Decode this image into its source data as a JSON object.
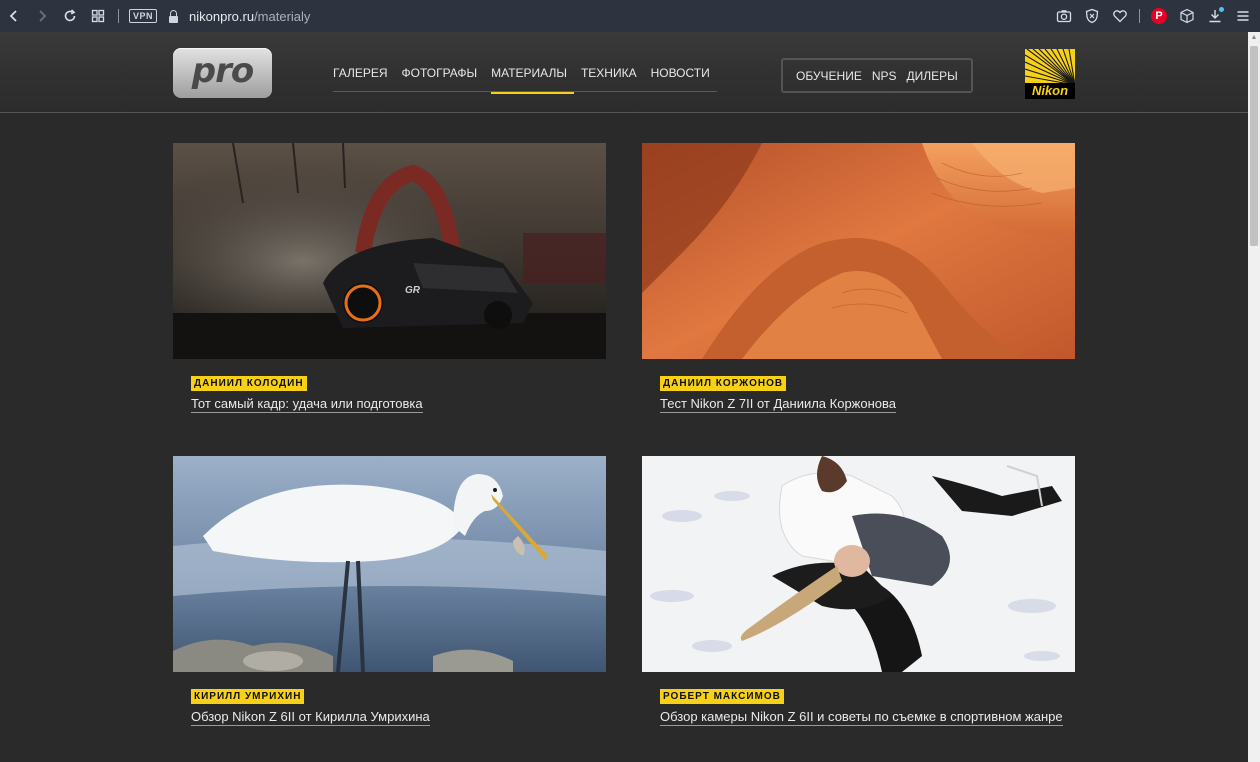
{
  "browser": {
    "url_host": "nikonpro.ru",
    "url_path": "/materialy",
    "vpn_label": "VPN",
    "pinterest_label": "P"
  },
  "header": {
    "logo_text": "pro",
    "main_nav": [
      "ГАЛЕРЕЯ",
      "ФОТОГРАФЫ",
      "МАТЕРИАЛЫ",
      "ТЕХНИКА",
      "НОВОСТИ"
    ],
    "active_nav": "МАТЕРИАЛЫ",
    "side_nav": [
      "ОБУЧЕНИЕ",
      "NPS",
      "ДИЛЕРЫ"
    ],
    "brand_logo_text": "Nikon"
  },
  "articles": [
    {
      "author": "ДАНИИЛ КОЛОДИН",
      "title": "Тот самый кадр: удача или подготовка",
      "image": "drift-car-photo"
    },
    {
      "author": "ДАНИИЛ КОРЖОНОВ",
      "title": "Тест Nikon Z 7II от Даниила Коржонова",
      "image": "desert-dunes-photo"
    },
    {
      "author": "КИРИЛЛ УМРИХИН",
      "title": "Обзор Nikon Z 6II от Кирилла Умрихина",
      "image": "egret-photo"
    },
    {
      "author": "РОБЕРТ МАКСИМОВ",
      "title": "Обзор камеры Nikon Z 6II и советы по съемке в спортивном жанре",
      "image": "figure-skaters-photo"
    }
  ],
  "colors": {
    "accent": "#f7d117",
    "page_bg": "#2a2a2a",
    "browser_bar": "#2d3440"
  }
}
